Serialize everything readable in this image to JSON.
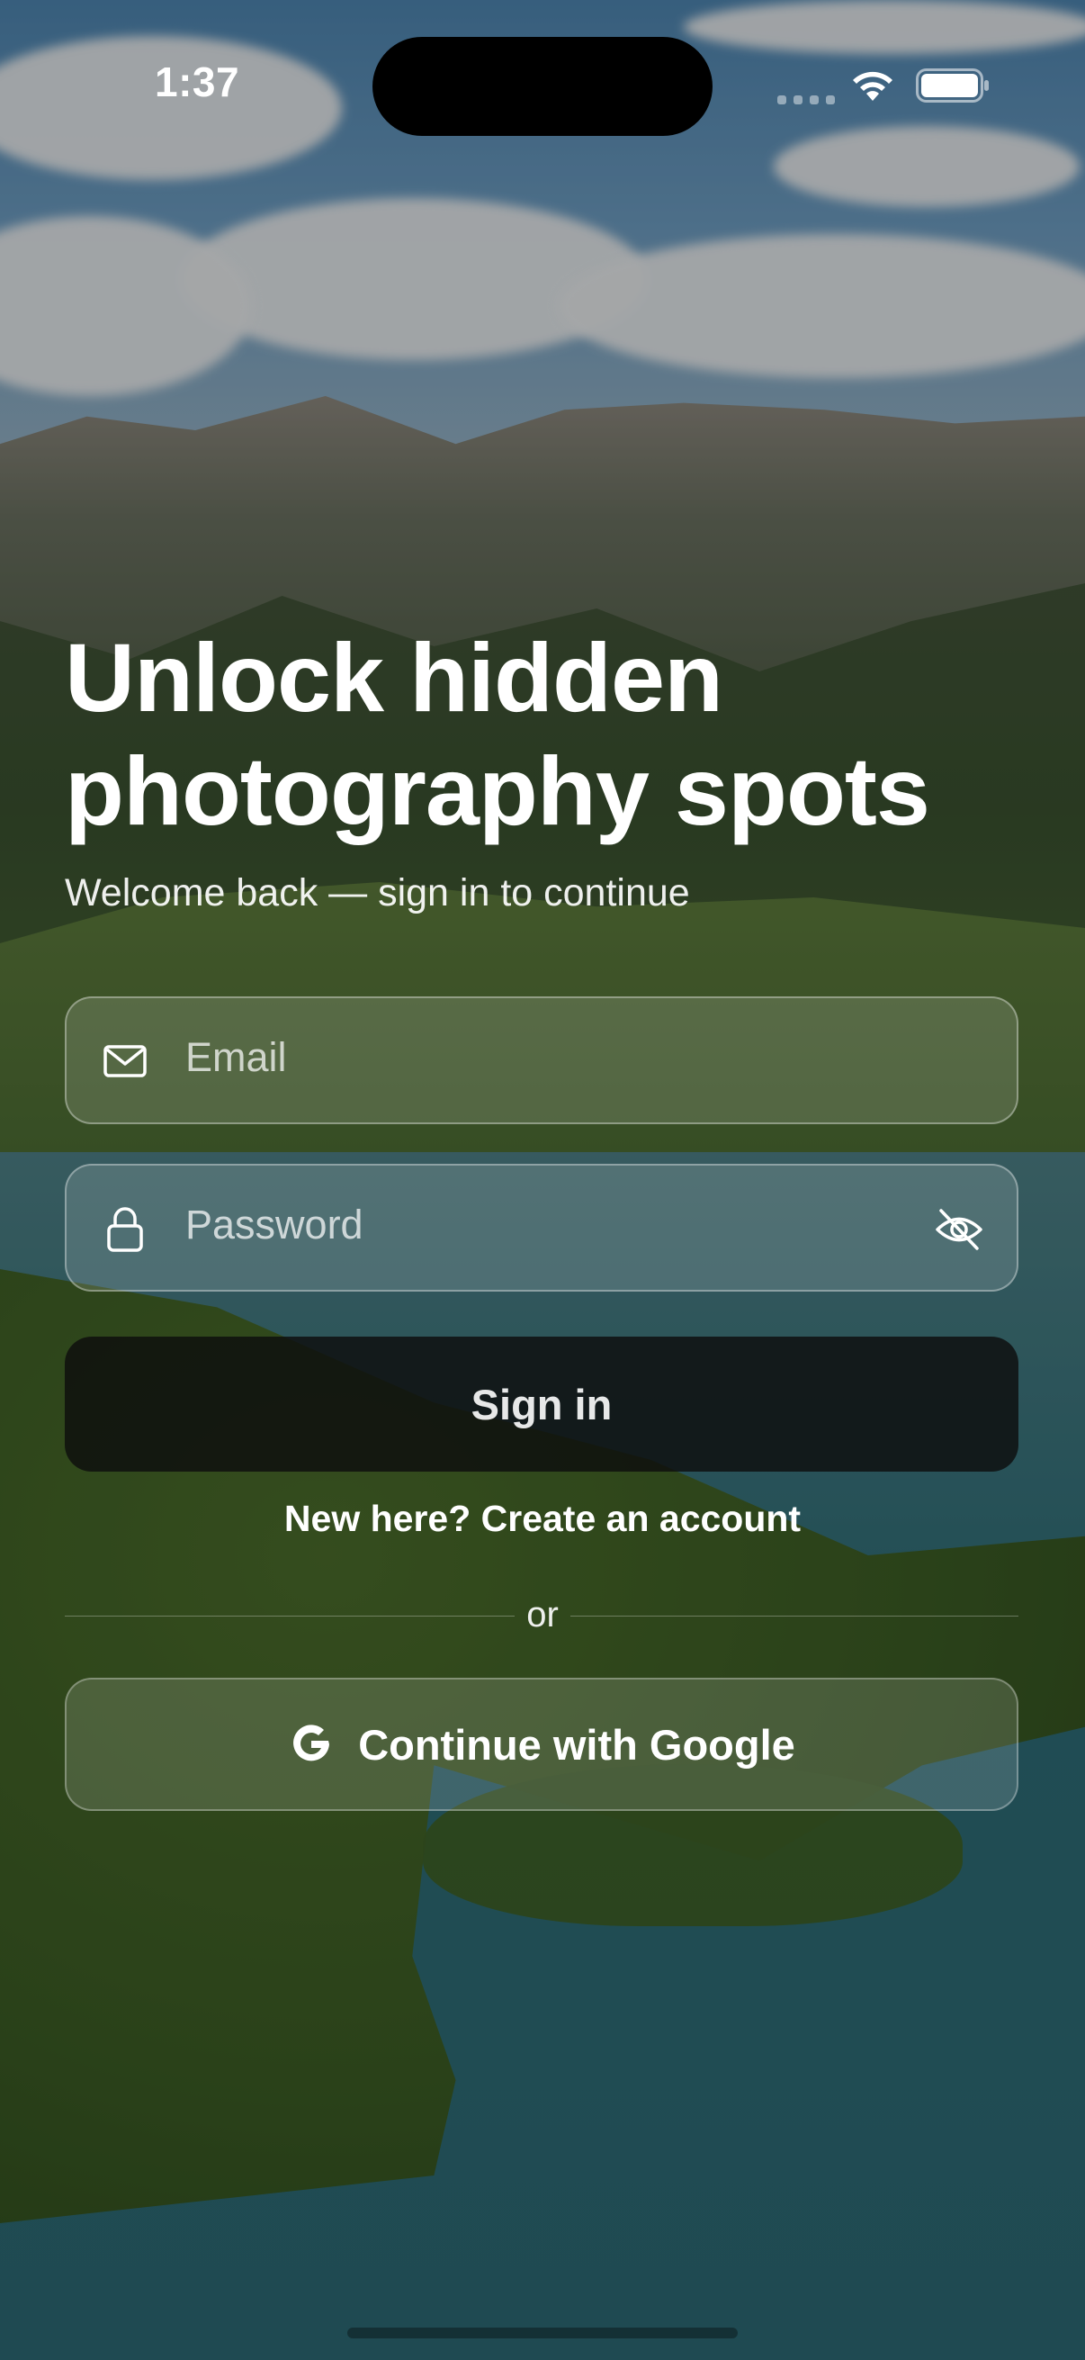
{
  "status_bar": {
    "time": "1:37"
  },
  "hero": {
    "title_line1": "Unlock hidden",
    "title_line2": "photography spots",
    "subtitle": "Welcome back — sign in to continue"
  },
  "form": {
    "email_placeholder": "Email",
    "password_placeholder": "Password",
    "signin_label": "Sign in",
    "create_account_label": "New here? Create an account",
    "divider_label": "or",
    "google_label": "Continue with Google"
  },
  "icons": {
    "email": "mail-icon",
    "password": "lock-icon",
    "visibility": "eye-off-icon",
    "google": "google-icon"
  }
}
